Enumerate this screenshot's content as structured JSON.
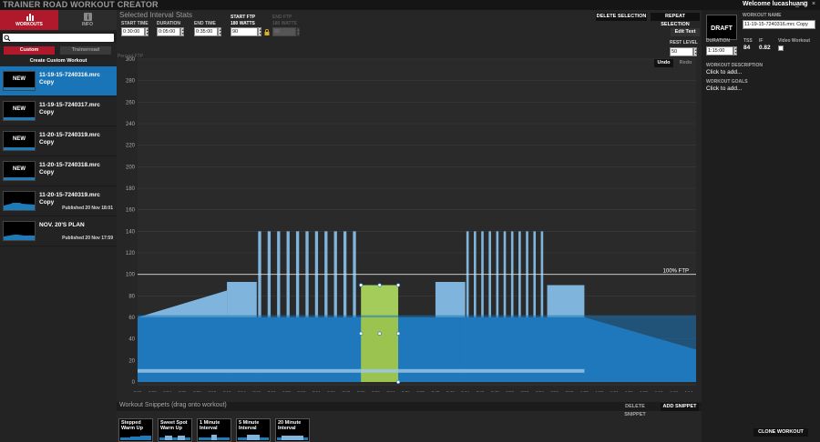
{
  "app": {
    "title": "TRAINER ROAD WORKOUT CREATOR",
    "welcome": "Welcome lucashuang",
    "window_controls": [
      "_",
      "□",
      "×"
    ]
  },
  "left": {
    "nav": [
      {
        "label": "WORKOUTS",
        "icon": "bar-chart-icon"
      },
      {
        "label": "INFO",
        "icon": "info-icon"
      }
    ],
    "search": {
      "value": "",
      "icon": "search-icon"
    },
    "subtabs": [
      "Custom",
      "Trainerroad"
    ],
    "create_label": "Create Custom Workout",
    "workouts": [
      {
        "name": "11-19-15-7240316.mrc",
        "sub": "Copy",
        "thumb": "NEW",
        "published": "",
        "selected": true
      },
      {
        "name": "11-19-15-7240317.mrc",
        "sub": "Copy",
        "thumb": "NEW",
        "published": "",
        "selected": false
      },
      {
        "name": "11-20-15-7240319.mrc",
        "sub": "Copy",
        "thumb": "NEW",
        "published": "",
        "selected": false
      },
      {
        "name": "11-20-15-7240318.mrc",
        "sub": "Copy",
        "thumb": "NEW",
        "published": "",
        "selected": false
      },
      {
        "name": "11-20-15-7240319.mrc",
        "sub": "Copy",
        "thumb": "",
        "published": "Published 20 Nov 18:01",
        "selected": false
      },
      {
        "name": "NOV. 20'S PLAN",
        "sub": "",
        "thumb": "",
        "published": "Published 20 Nov 17:59",
        "selected": false
      }
    ]
  },
  "stats": {
    "title": "Selected Interval Stats",
    "start_time": {
      "label": "START TIME",
      "value": "0:30:00"
    },
    "duration": {
      "label": "DURATION",
      "value": "0:05:00"
    },
    "end_time": {
      "label": "END TIME",
      "value": "0:35:00"
    },
    "start_ftp": {
      "label": "START FTP",
      "watts": "180 WATTS",
      "value": "90"
    },
    "end_ftp": {
      "label": "END FTP",
      "watts": "180 WATTS",
      "value": "90"
    },
    "buttons": {
      "delete": "DELETE SELECTION",
      "repeat": "REPEAT SELECTION",
      "edit_text": "Edit Text"
    },
    "rest_level": {
      "label": "REST LEVEL",
      "value": "50"
    },
    "undo": "Undo",
    "redo": "Redo"
  },
  "chart_data": {
    "type": "area",
    "ylabel": "Percent FTP",
    "ylim": [
      0,
      300
    ],
    "yticks": [
      0,
      20,
      40,
      60,
      80,
      100,
      120,
      140,
      160,
      180,
      200,
      220,
      240,
      260,
      280,
      300
    ],
    "xticks": [
      "0:00",
      "0:02",
      "0:04",
      "0:06",
      "0:08",
      "0:10",
      "0:12",
      "0:14",
      "0:16",
      "0:18",
      "0:20",
      "0:22",
      "0:24",
      "0:26",
      "0:28",
      "0:30",
      "0:32",
      "0:34",
      "0:36",
      "0:38",
      "0:40",
      "0:42",
      "0:44",
      "0:46",
      "0:48",
      "0:50",
      "0:52",
      "0:54",
      "0:56",
      "0:58",
      "1:00",
      "1:02",
      "1:04",
      "1:06",
      "1:08",
      "1:10",
      "1:12",
      "1:14"
    ],
    "xlim_min": [
      0,
      75
    ],
    "ftp_line": {
      "value": 100,
      "label": "100% FTP"
    },
    "intervals": [
      {
        "start": 0,
        "end": 12,
        "from": 60,
        "to": 85
      },
      {
        "start": 12,
        "end": 16,
        "from": 93,
        "to": 93
      },
      {
        "start": 16,
        "end": 30,
        "type": "spikes",
        "base": 60,
        "peak": 140,
        "count": 11
      },
      {
        "start": 30,
        "end": 35,
        "from": 90,
        "to": 90,
        "selected": true
      },
      {
        "start": 35,
        "end": 40,
        "from": 60,
        "to": 60
      },
      {
        "start": 40,
        "end": 44,
        "from": 93,
        "to": 93
      },
      {
        "start": 44,
        "end": 55,
        "type": "spikes",
        "base": 60,
        "peak": 140,
        "count": 11
      },
      {
        "start": 55,
        "end": 60,
        "from": 90,
        "to": 90
      },
      {
        "start": 60,
        "end": 75,
        "from": 60,
        "to": 30
      }
    ]
  },
  "snippets": {
    "title": "Workout Snippets (drag onto workout)",
    "delete": "DELETE SNIPPET",
    "add": "ADD SNIPPET",
    "items": [
      "Stepped Warm Up",
      "Sweet Spot Warm Up",
      "1 Minute Interval",
      "5 Minute Interval",
      "20 Minute Interval"
    ]
  },
  "right": {
    "draft": "DRAFT",
    "workout_name": {
      "label": "WORKOUT NAME",
      "value": "11-19-15-7240316.mrc Copy"
    },
    "duration": {
      "label": "DURATION",
      "value": "1:15:00"
    },
    "tss": {
      "label": "TSS",
      "value": "84"
    },
    "if": {
      "label": "IF",
      "value": "0.82"
    },
    "video": {
      "label": "Video Workout"
    },
    "description": {
      "label": "WORKOUT DESCRIPTION",
      "value": "Click to add..."
    },
    "goals": {
      "label": "WORKOUT GOALS",
      "value": "Click to add..."
    },
    "clone": "CLONE WORKOUT"
  },
  "colors": {
    "accent_blue": "#1a74b8",
    "light_blue": "#7fb5dc",
    "selected_green": "#a3cc5a",
    "tab_red": "#b0192b",
    "selected_row": "#1a74b8"
  }
}
